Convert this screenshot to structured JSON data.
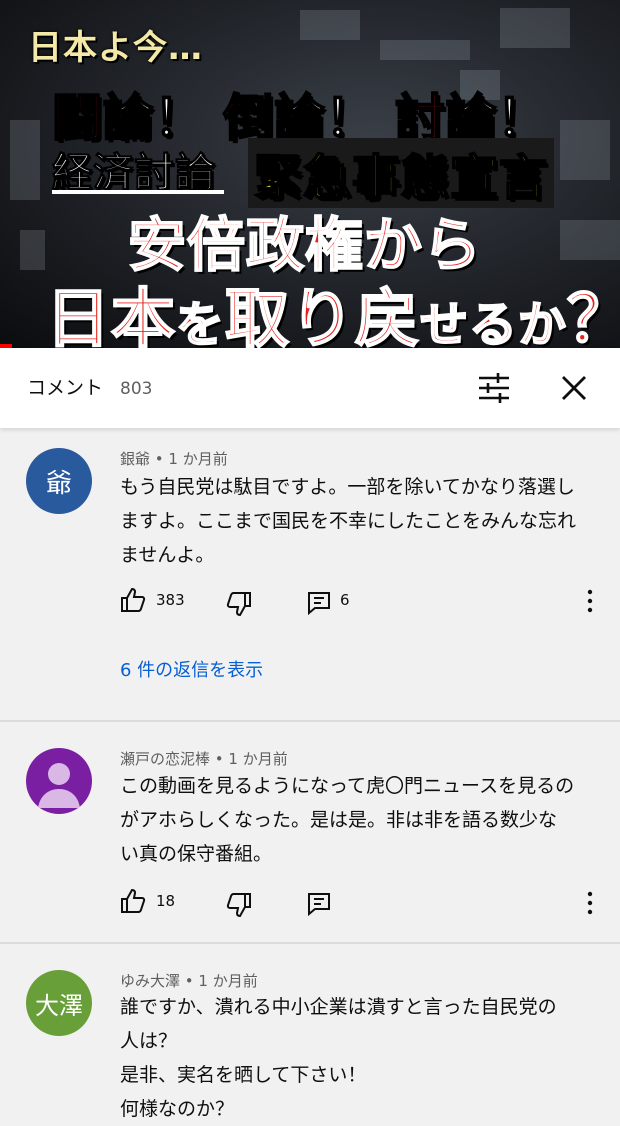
{
  "video_thumbnail": {
    "line1": "日本よ今…",
    "line2_parts": [
      "闘",
      "論！",
      "倒",
      "論！",
      "討",
      "論！"
    ],
    "line3_left": "経済討論",
    "line3_right": "緊急事態宣言",
    "line4": "安倍政権から",
    "line5_big": "日本",
    "line5_small1": "を",
    "line5_big2": "取り戻",
    "line5_small2": "せるか",
    "line5_q": "？",
    "progress_fraction": 0.02
  },
  "header": {
    "title": "コメント",
    "count": "803",
    "filter_icon": "tune-icon",
    "close_icon": "close-icon"
  },
  "comments": [
    {
      "avatar_text": "爺",
      "avatar_color": "#2a5a9e",
      "author": "銀爺",
      "time": "1 か月前",
      "lines": [
        "もう自民党は駄目ですよ。一部を除いてかなり落選し",
        "ますよ。ここまで国民を不幸にしたことをみんな忘れ",
        "ませんよ。"
      ],
      "likes": "383",
      "reply_count": "6",
      "view_replies": "6 件の返信を表示"
    },
    {
      "avatar_text": "",
      "avatar_color": "#7b1fa2",
      "author": "瀬戸の恋泥棒",
      "time": "1 か月前",
      "lines": [
        "この動画を見るようになって虎〇門ニュースを見るの",
        "がアホらしくなった。是は是。非は非を語る数少な",
        "い真の保守番組。"
      ],
      "likes": "18"
    },
    {
      "avatar_text": "大澤",
      "avatar_color": "#689f38",
      "author": "ゆみ大澤",
      "time": "1 か月前",
      "lines": [
        "誰ですか、潰れる中小企業は潰すと言った自民党の",
        "人は？",
        "是非、実名を晒して下さい！",
        "何様なのか？"
      ]
    }
  ]
}
